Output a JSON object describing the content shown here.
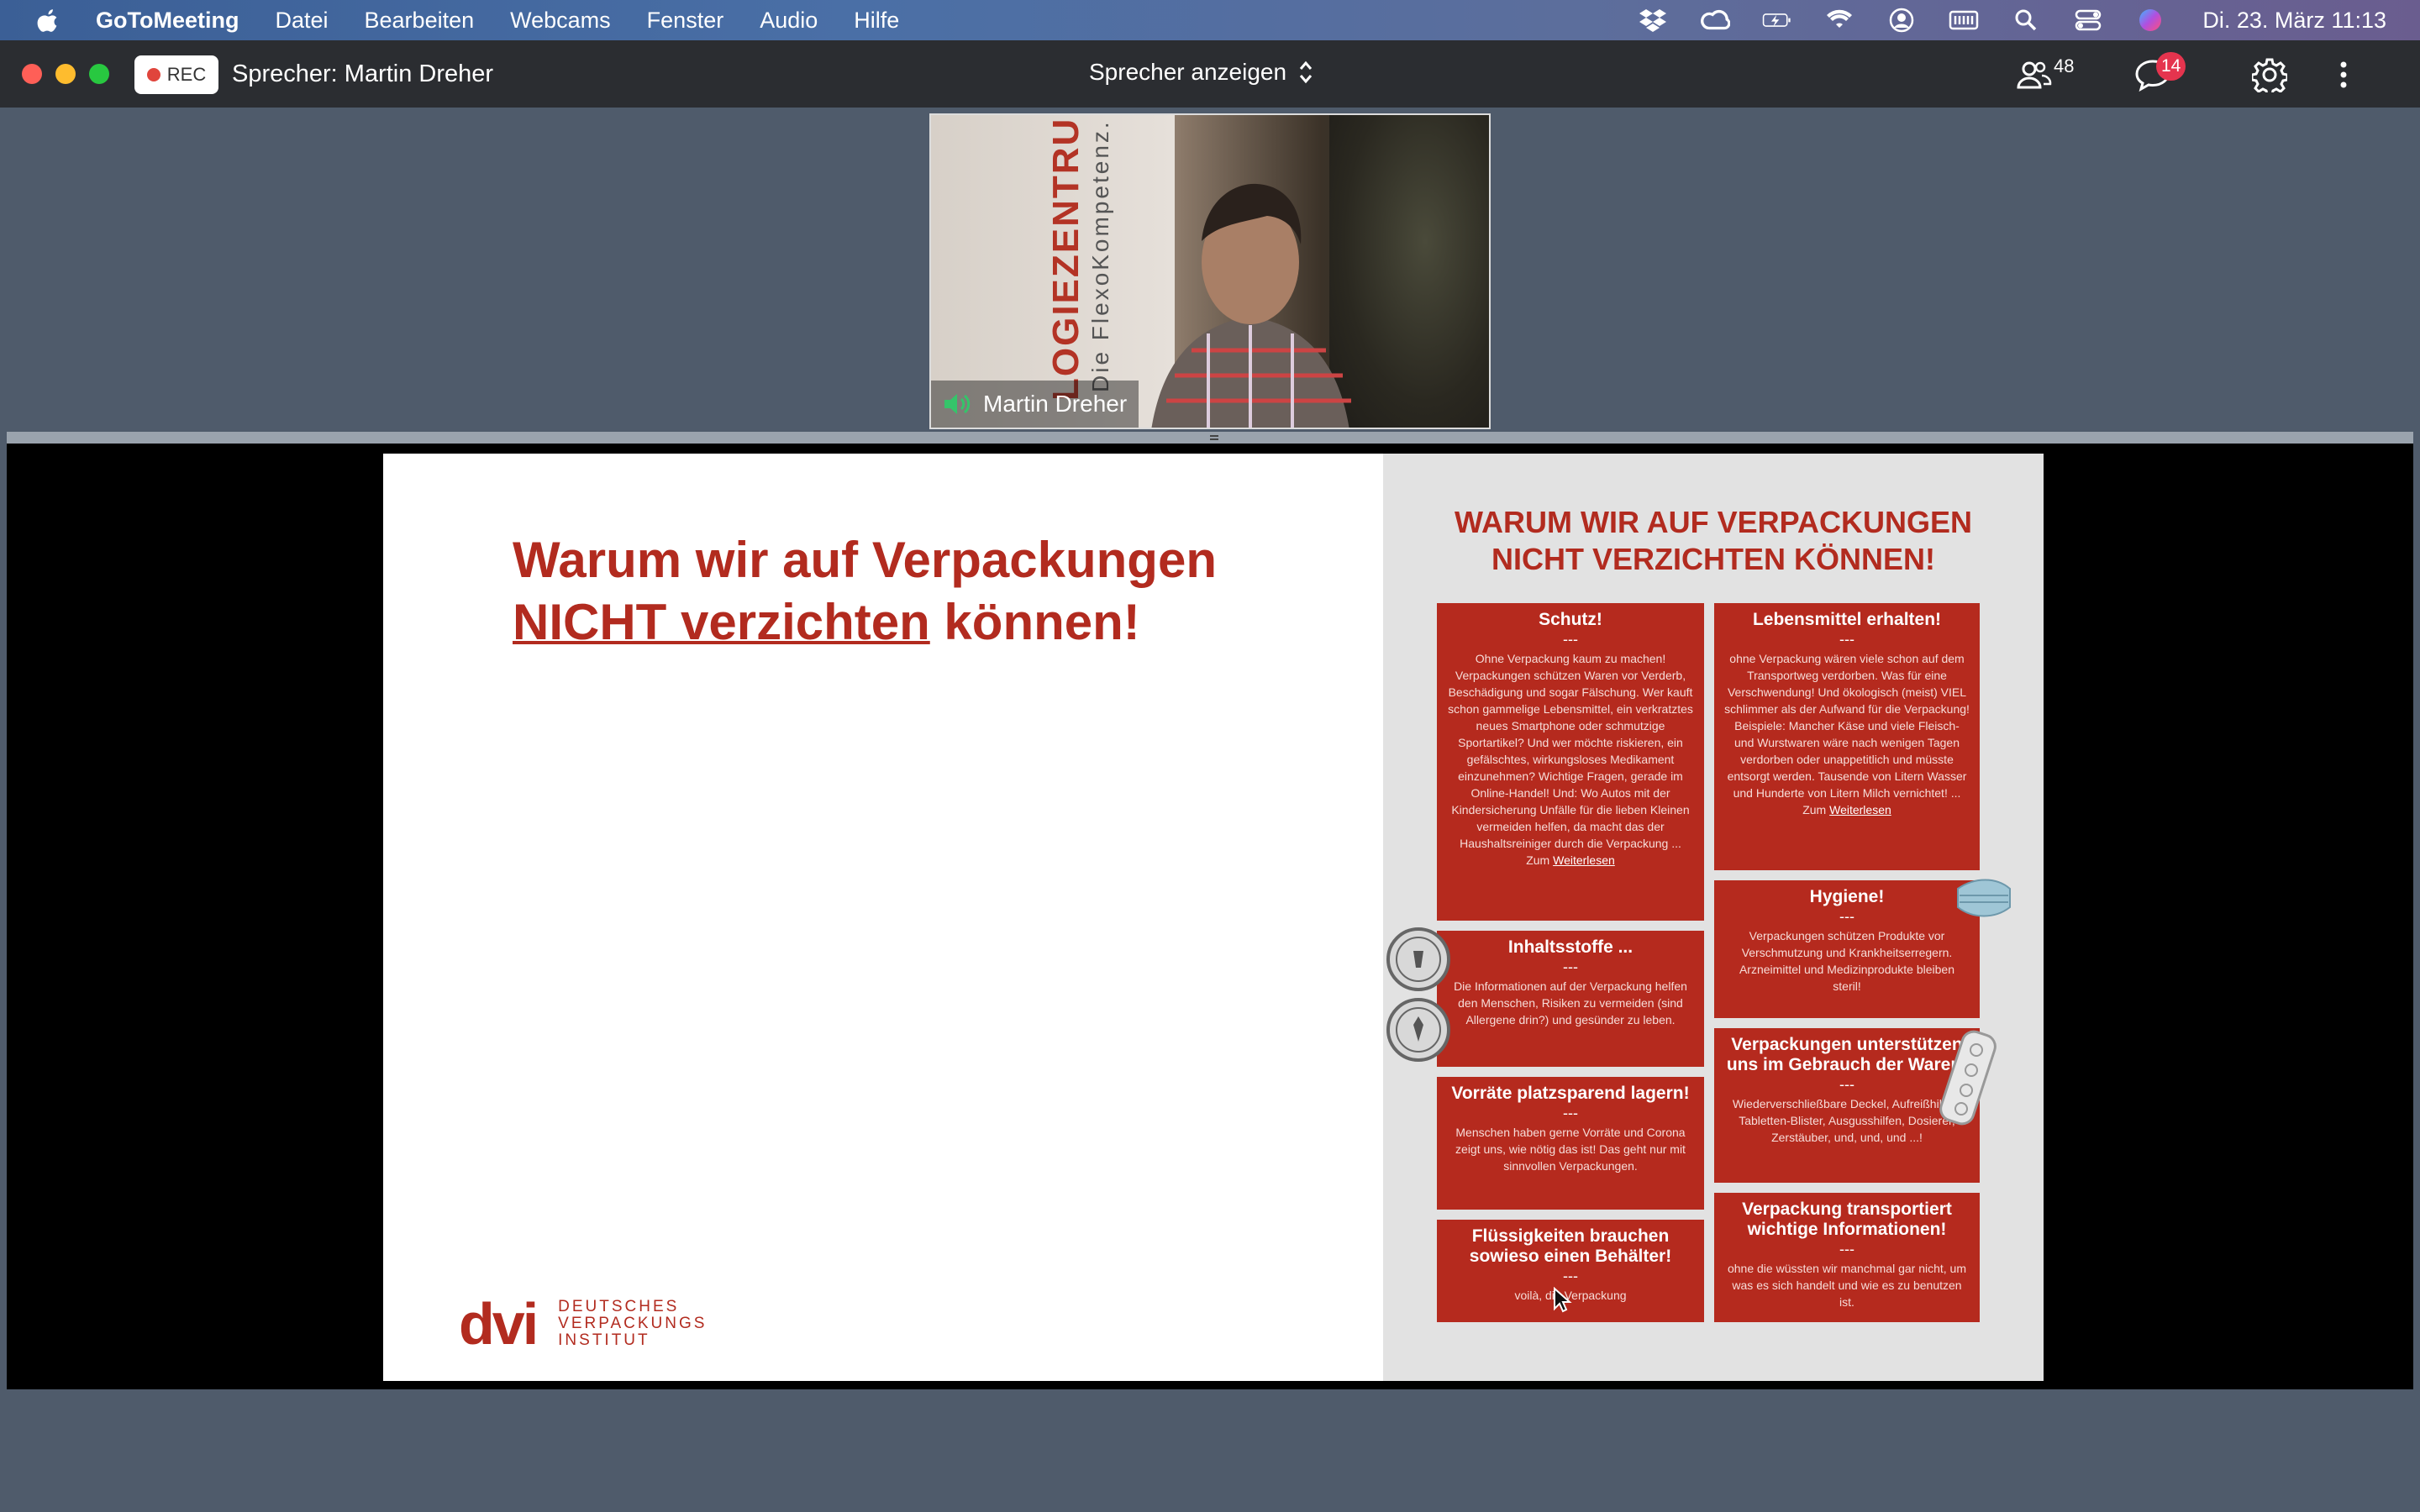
{
  "menubar": {
    "app_name": "GoToMeeting",
    "items": [
      "Datei",
      "Bearbeiten",
      "Webcams",
      "Fenster",
      "Audio",
      "Hilfe"
    ],
    "clock": "Di. 23. März  11:13"
  },
  "toolbar": {
    "rec_label": "REC",
    "speaker_label": "Sprecher: Martin Dreher",
    "view_label": "Sprecher anzeigen",
    "attendees_count": "48",
    "chat_badge": "14"
  },
  "webcam": {
    "name": "Martin Dreher",
    "banner_text": "LOGIEZENTRUM",
    "banner_sub": "Die FlexoKompetenz."
  },
  "slide": {
    "title_line1": "Warum wir auf Verpackungen",
    "title_line2_underlined": "NICHT verzichten",
    "title_line2_rest": " können!",
    "logo_mark": "dvi",
    "logo_words": [
      "DEUTSCHES",
      "VERPACKUNGS",
      "INSTITUT"
    ],
    "panel_title_line1": "WARUM WIR AUF VERPACKUNGEN",
    "panel_title_line2": "NICHT VERZICHTEN KÖNNEN!",
    "dash": "---",
    "cards": [
      {
        "title": "Schutz!",
        "body": "Ohne Verpackung kaum zu machen! Verpackungen schützen Waren vor Verderb, Beschädigung und sogar Fälschung. Wer kauft schon gammelige Lebensmittel, ein verkratztes neues Smartphone oder schmutzige Sportartikel? Und wer möchte riskieren, ein gefälschtes, wirkungsloses Medikament einzunehmen? Wichtige Fragen, gerade im Online-Handel! Und: Wo Autos mit der Kindersicherung Unfälle für die lieben Kleinen vermeiden helfen, da macht das der Haushaltsreiniger durch die Verpackung ... Zum",
        "link": "Weiterlesen"
      },
      {
        "title": "Lebensmittel erhalten!",
        "body": "ohne Verpackung wären viele schon auf dem Transportweg verdorben. Was für eine Verschwendung! Und ökologisch (meist) VIEL schlimmer als der Aufwand für die Verpackung! Beispiele: Mancher Käse und viele Fleisch- und Wurstwaren wäre nach wenigen Tagen verdorben oder unappetitlich und müsste entsorgt werden. Tausende von Litern Wasser und Hunderte von Litern Milch vernichtet! ... Zum",
        "link": "Weiterlesen"
      },
      {
        "title": "Hygiene!",
        "body": "Verpackungen schützen Produkte vor Verschmutzung und Krankheitserregern. Arzneimittel und Medizinprodukte bleiben steril!",
        "link": ""
      },
      {
        "title": "Inhaltsstoffe ...",
        "body": "Die Informationen auf der Verpackung helfen den Menschen, Risiken zu vermeiden (sind Allergene drin?) und gesünder zu leben.",
        "link": ""
      },
      {
        "title": "Verpackungen unterstützen uns im Gebrauch der Waren!",
        "body": "Wiederverschließbare Deckel, Aufreißhilfen, Tabletten-Blister, Ausgusshilfen, Dosierer, Zerstäuber, und, und, und ...!",
        "link": ""
      },
      {
        "title": "Vorräte platzsparend lagern!",
        "body": "Menschen haben gerne Vorräte und Corona zeigt uns, wie nötig das ist! Das geht nur mit sinnvollen Verpackungen.",
        "link": ""
      },
      {
        "title": "Flüssigkeiten brauchen sowieso einen Behälter!",
        "body": "voilà, die Verpackung",
        "link": ""
      },
      {
        "title": "Verpackung transportiert wichtige Informationen!",
        "body": "ohne die wüssten wir manchmal gar nicht, um was es sich handelt und wie es zu benutzen ist.",
        "link": ""
      }
    ]
  },
  "icons": {
    "apple": "apple-icon",
    "dropbox": "dropbox-icon",
    "creative_cloud": "creative-cloud-icon",
    "battery": "battery-icon",
    "wifi": "wifi-icon",
    "user": "user-icon",
    "keyboard": "keyboard-icon",
    "search": "search-icon",
    "control_center": "control-center-icon",
    "siri": "siri-icon",
    "people": "people-icon",
    "chat": "chat-icon",
    "gear": "gear-icon",
    "more": "more-icon",
    "speaker": "speaker-icon"
  },
  "colors": {
    "accent_red": "#b22b1f",
    "card_red": "#b52a1e",
    "badge_red": "#e5344e",
    "speaker_green": "#35c46a"
  }
}
